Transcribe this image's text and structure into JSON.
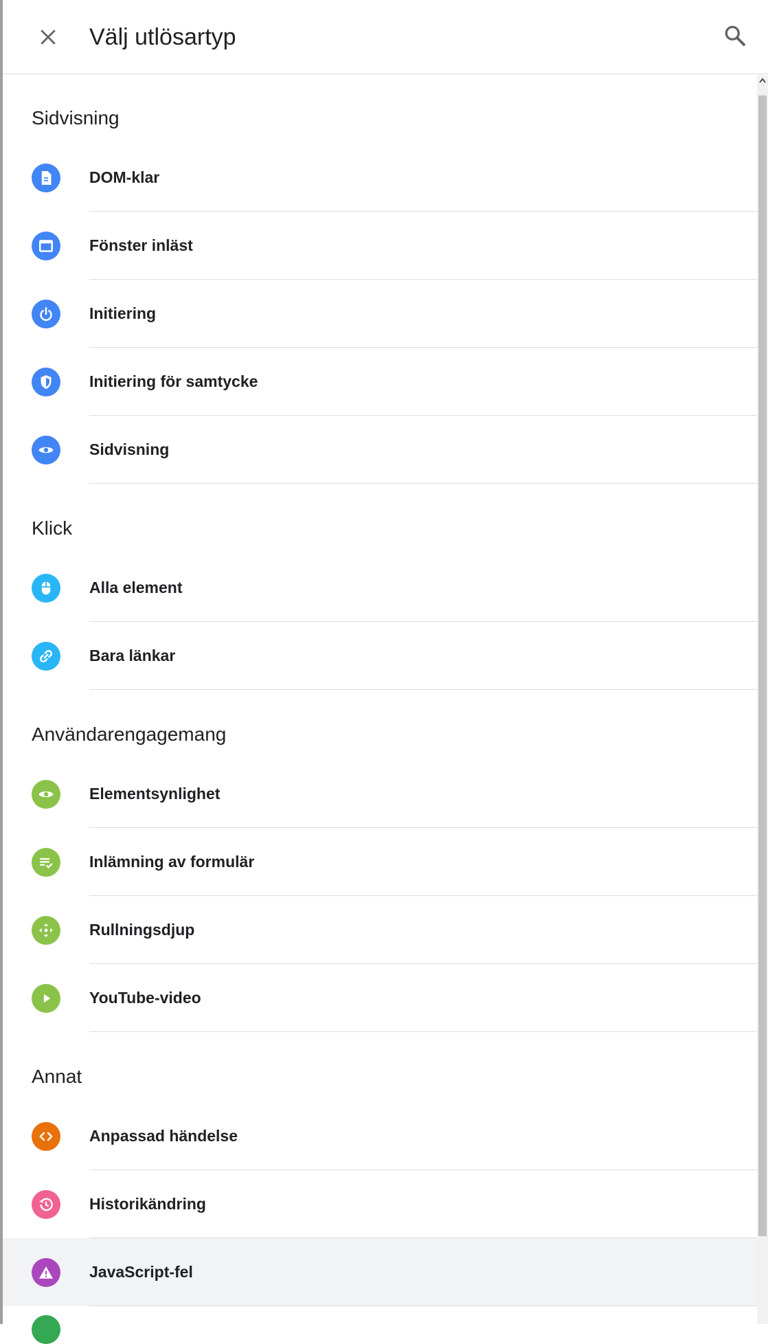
{
  "header": {
    "title": "Välj utlösartyp",
    "close_icon": "close-icon",
    "search_icon": "search-icon"
  },
  "colors": {
    "blue": "#4285f4",
    "light_blue": "#29b6f6",
    "green": "#8bc34a",
    "orange": "#e8710a",
    "pink": "#f06292",
    "purple": "#ab47bc",
    "dark_green": "#34a853"
  },
  "sections": [
    {
      "title": "Sidvisning",
      "items": [
        {
          "label": "DOM-klar",
          "icon": "document-icon",
          "color": "#4285f4"
        },
        {
          "label": "Fönster inläst",
          "icon": "window-icon",
          "color": "#4285f4"
        },
        {
          "label": "Initiering",
          "icon": "power-icon",
          "color": "#4285f4"
        },
        {
          "label": "Initiering för samtycke",
          "icon": "shield-icon",
          "color": "#4285f4"
        },
        {
          "label": "Sidvisning",
          "icon": "eye-icon",
          "color": "#4285f4"
        }
      ]
    },
    {
      "title": "Klick",
      "items": [
        {
          "label": "Alla element",
          "icon": "mouse-icon",
          "color": "#29b6f6"
        },
        {
          "label": "Bara länkar",
          "icon": "link-icon",
          "color": "#29b6f6"
        }
      ]
    },
    {
      "title": "Användarengagemang",
      "items": [
        {
          "label": "Elementsynlighet",
          "icon": "eye-icon",
          "color": "#8bc34a"
        },
        {
          "label": "Inlämning av formulär",
          "icon": "form-check-icon",
          "color": "#8bc34a"
        },
        {
          "label": "Rullningsdjup",
          "icon": "move-arrows-icon",
          "color": "#8bc34a"
        },
        {
          "label": "YouTube-video",
          "icon": "play-icon",
          "color": "#8bc34a"
        }
      ]
    },
    {
      "title": "Annat",
      "items": [
        {
          "label": "Anpassad händelse",
          "icon": "code-icon",
          "color": "#e8710a"
        },
        {
          "label": "Historikändring",
          "icon": "history-icon",
          "color": "#f06292"
        },
        {
          "label": "JavaScript-fel",
          "icon": "warning-icon",
          "color": "#ab47bc",
          "highlighted": true
        }
      ]
    }
  ]
}
